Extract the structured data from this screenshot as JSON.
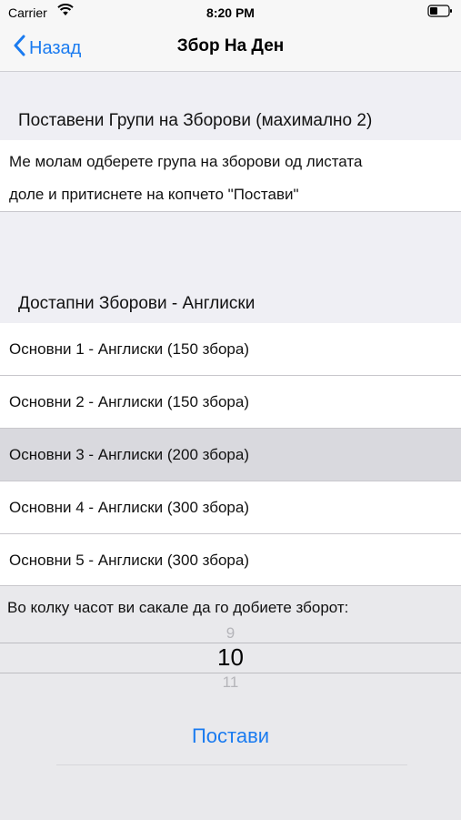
{
  "status_bar": {
    "carrier": "Carrier",
    "time": "8:20 PM",
    "wifi_icon": "wifi-icon",
    "battery_icon": "battery-icon"
  },
  "nav": {
    "back_label": "Назад",
    "title": "Збор На Ден",
    "accent_color": "#1a7bf0"
  },
  "selected_section": {
    "header": "Поставени Групи на Зборови (махимално 2)",
    "info_line1": "Ме молам одберете група на зборови од листата",
    "info_line2": "доле и притиснете на копчето \"Постави\""
  },
  "available_section": {
    "header": "Достапни Зборови - Англиски",
    "items": [
      {
        "label": "Основни 1 - Англиски (150 збора)",
        "selected": false
      },
      {
        "label": "Основни 2 - Англиски (150 збора)",
        "selected": false
      },
      {
        "label": "Основни 3 - Англиски (200 збора)",
        "selected": true
      },
      {
        "label": "Основни 4 - Англиски (300 збора)",
        "selected": false
      },
      {
        "label": "Основни 5 - Англиски (300 збора)",
        "selected": false
      }
    ]
  },
  "time_picker": {
    "label": "Во колку часот ви сакале да го добиете зборот:",
    "prev_value": "9",
    "current_value": "10",
    "next_value": "11"
  },
  "set_button_label": "Постави"
}
